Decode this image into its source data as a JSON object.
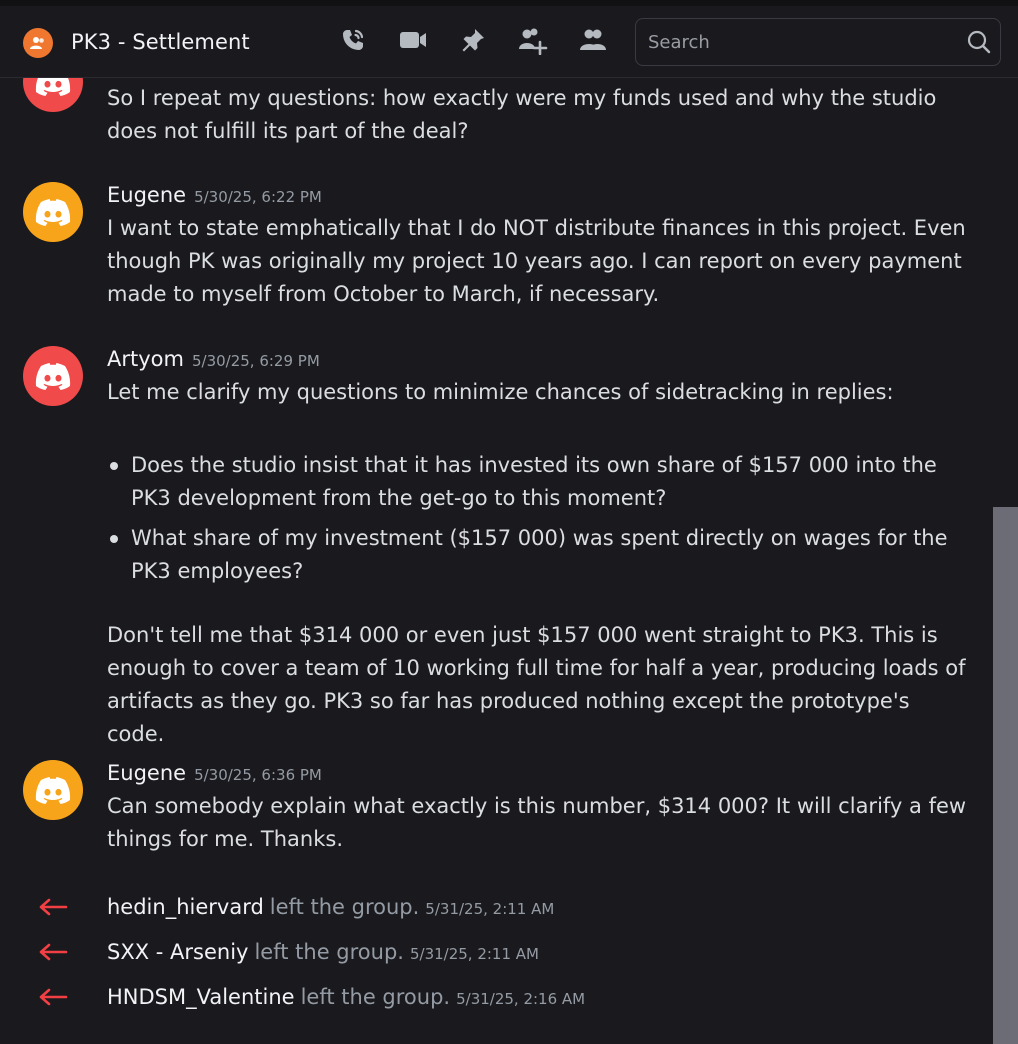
{
  "header": {
    "title": "PK3 - Settlement",
    "search_placeholder": "Search"
  },
  "messages": [
    {
      "author": "",
      "timestamp": "",
      "text": "So I repeat my questions: how exactly were my funds used and why the studio does not fulfill its part of the deal?"
    },
    {
      "author": "Eugene",
      "timestamp": "5/30/25, 6:22 PM",
      "text": "I want to state emphatically that I do NOT distribute finances in this project. Even though PK was originally my project 10 years ago. I can report on every payment made to myself from October to March, if necessary."
    },
    {
      "author": "Artyom",
      "timestamp": "5/30/25, 6:29 PM",
      "intro": "Let me clarify my questions to minimize chances of sidetracking in replies:",
      "bullets": [
        "Does the studio insist that it has invested its own share of $157 000 into the PK3 development from the get-go to this moment?",
        "What share of my investment ($157 000) was spent directly on wages for the PK3 employees?"
      ],
      "outro": "Don't tell me that $314 000 or even just $157 000 went straight to PK3. This is enough to cover a team of 10 working full time for half a year, producing loads of artifacts as they go. PK3 so far has produced nothing except the prototype's code."
    },
    {
      "author": "Eugene",
      "timestamp": "5/30/25, 6:36 PM",
      "text": "Can somebody explain what exactly is this number, $314 000? It will clarify a few things for me. Thanks."
    }
  ],
  "system_events": [
    {
      "user": "hedin_hiervard",
      "action": "left the group.",
      "timestamp": "5/31/25, 2:11 AM"
    },
    {
      "user": "SXX - Arseniy",
      "action": "left the group.",
      "timestamp": "5/31/25, 2:11 AM"
    },
    {
      "user": "HNDSM_Valentine",
      "action": "left the group.",
      "timestamp": "5/31/25, 2:16 AM"
    }
  ],
  "colors": {
    "background": "#1a1a1e",
    "avatar_red": "#f04a4a",
    "avatar_yellow": "#f8a41b",
    "group_icon": "#f0772f",
    "leave_arrow": "#f23f43"
  },
  "icons": [
    "group-dm-icon",
    "phone-call-icon",
    "video-call-icon",
    "pin-icon",
    "add-friends-icon",
    "member-list-icon",
    "search-icon",
    "discord-logo-icon",
    "leave-arrow-icon"
  ]
}
